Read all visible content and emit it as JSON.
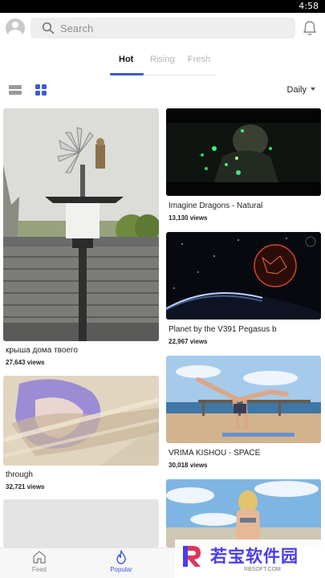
{
  "status": {
    "time": "4:58"
  },
  "search": {
    "placeholder": "Search"
  },
  "tabs": [
    {
      "label": "Hot",
      "active": true
    },
    {
      "label": "Rising",
      "active": false
    },
    {
      "label": "Fresh",
      "active": false
    }
  ],
  "view": {
    "period": "Daily"
  },
  "left_column": [
    {
      "title": "крыша дома твоего",
      "views": "27,643 views"
    },
    {
      "title": "through",
      "views": "32,721 views"
    },
    {
      "title": "",
      "views": ""
    }
  ],
  "right_column": [
    {
      "title": "Imagine Dragons - Natural",
      "views": "13,130 views"
    },
    {
      "title": "Planet by the V391 Pegasus b",
      "views": "22,967 views"
    },
    {
      "title": "VRIMA KISHOU - SPACE",
      "views": "30,018 views"
    },
    {
      "title": "",
      "views": ""
    }
  ],
  "bottom_nav": [
    {
      "label": "Feed",
      "active": false
    },
    {
      "label": "Popular",
      "active": true
    }
  ],
  "watermark": {
    "text": "若宝软件园",
    "sub": "RBSOFT.COM"
  },
  "colors": {
    "accent": "#3f5bd8",
    "watermark": "#4a3cf1"
  }
}
